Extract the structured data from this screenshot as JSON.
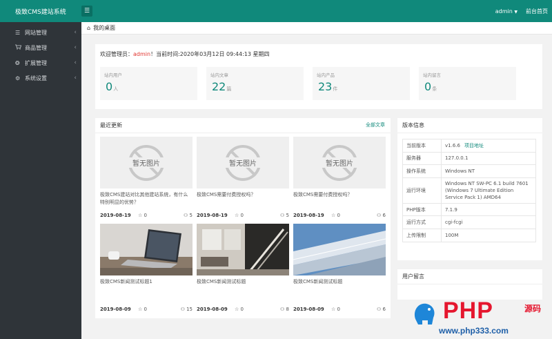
{
  "header": {
    "site_title": "极致CMS建站系统",
    "menu_icon": "menu-icon",
    "user": "admin",
    "user_caret": "▼",
    "front_link": "前台首页"
  },
  "sidebar": {
    "items": [
      {
        "label": "网站管理",
        "icon": "list-icon"
      },
      {
        "label": "商品管理",
        "icon": "cart-icon"
      },
      {
        "label": "扩展管理",
        "icon": "puzzle-icon"
      },
      {
        "label": "系统设置",
        "icon": "gear-icon"
      }
    ]
  },
  "breadcrumb": {
    "label": "我的桌面",
    "icon": "home-icon"
  },
  "welcome": {
    "prefix": "欢迎管理员：",
    "user": "admin",
    "suffix": "！当前时间:2020年03月12日 09:44:13 星期四"
  },
  "stats": [
    {
      "label": "站内用户",
      "value": "0",
      "unit": "人"
    },
    {
      "label": "站内文章",
      "value": "22",
      "unit": "篇"
    },
    {
      "label": "站内产品",
      "value": "23",
      "unit": "件"
    },
    {
      "label": "站内留言",
      "value": "0",
      "unit": "条"
    }
  ],
  "recent": {
    "title": "最近更新",
    "more": "全部文章",
    "no_image": "暂无图片",
    "articles": [
      {
        "title": "极致CMS建站对比其他建站系统，有什么特别明显的优势？",
        "date": "2019-08-19",
        "likes": "0",
        "views": "5",
        "image": "none"
      },
      {
        "title": "极致CMS需要付费授权吗？",
        "date": "2019-08-19",
        "likes": "0",
        "views": "5",
        "image": "none"
      },
      {
        "title": "极致CMS需要付费授权吗？",
        "date": "2019-08-19",
        "likes": "0",
        "views": "6",
        "image": "none"
      },
      {
        "title": "极致CMS新闻测试标题1",
        "date": "2019-08-09",
        "likes": "0",
        "views": "15",
        "image": "laptop"
      },
      {
        "title": "极致CMS新闻测试标题",
        "date": "2019-08-09",
        "likes": "0",
        "views": "8",
        "image": "room"
      },
      {
        "title": "极致CMS新闻测试标题",
        "date": "2019-08-09",
        "likes": "0",
        "views": "6",
        "image": "building"
      }
    ]
  },
  "version": {
    "title": "版本信息",
    "rows": [
      {
        "key": "当前版本",
        "value": "v1.6.6",
        "link": "项目地址"
      },
      {
        "key": "服务器",
        "value": "127.0.0.1"
      },
      {
        "key": "操作系统",
        "value": "Windows NT"
      },
      {
        "key": "运行环境",
        "value": "Windows NT SW-PC 6.1 build 7601 (Windows 7 Ultimate Edition Service Pack 1) AMD64"
      },
      {
        "key": "PHP版本",
        "value": "7.1.9"
      },
      {
        "key": "运行方式",
        "value": "cgi-fcgi"
      },
      {
        "key": "上传限制",
        "value": "100M"
      }
    ]
  },
  "messages": {
    "title": "用户留言"
  },
  "watermark": {
    "brand": "PHP",
    "tag": "源码",
    "url": "www.php333.com",
    "colors": {
      "brand": "#e5162e",
      "elephant": "#1e86d8"
    }
  },
  "colors": {
    "accent": "#10897b",
    "sidebar": "#2f3439",
    "highlight": "#e1342f"
  }
}
